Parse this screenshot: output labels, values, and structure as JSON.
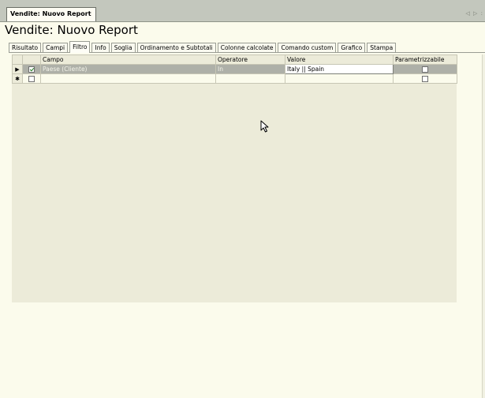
{
  "document_tab": {
    "label": "Vendite: Nuovo Report"
  },
  "nav_arrows": {
    "label": "◁ ▷ :"
  },
  "page_title": "Vendite: Nuovo Report",
  "tabs": [
    {
      "label": "Risultato",
      "active": false
    },
    {
      "label": "Campi",
      "active": false
    },
    {
      "label": "Filtro",
      "active": true
    },
    {
      "label": "Info",
      "active": false
    },
    {
      "label": "Soglia",
      "active": false
    },
    {
      "label": "Ordinamento e Subtotali",
      "active": false
    },
    {
      "label": "Colonne calcolate",
      "active": false
    },
    {
      "label": "Comando custom",
      "active": false
    },
    {
      "label": "Grafico",
      "active": false
    },
    {
      "label": "Stampa",
      "active": false
    }
  ],
  "grid": {
    "columns": {
      "campo": "Campo",
      "operatore": "Operatore",
      "valore": "Valore",
      "parametrizzabile": "Parametrizzabile"
    },
    "rows": [
      {
        "indicator": "▶",
        "enabled": true,
        "campo": "Paese (Cliente)",
        "operatore": "In",
        "valore": "Italy || Spain",
        "parametrizzabile": false
      }
    ],
    "new_row": {
      "indicator": "✱",
      "enabled": false,
      "parametrizzabile": false
    }
  }
}
